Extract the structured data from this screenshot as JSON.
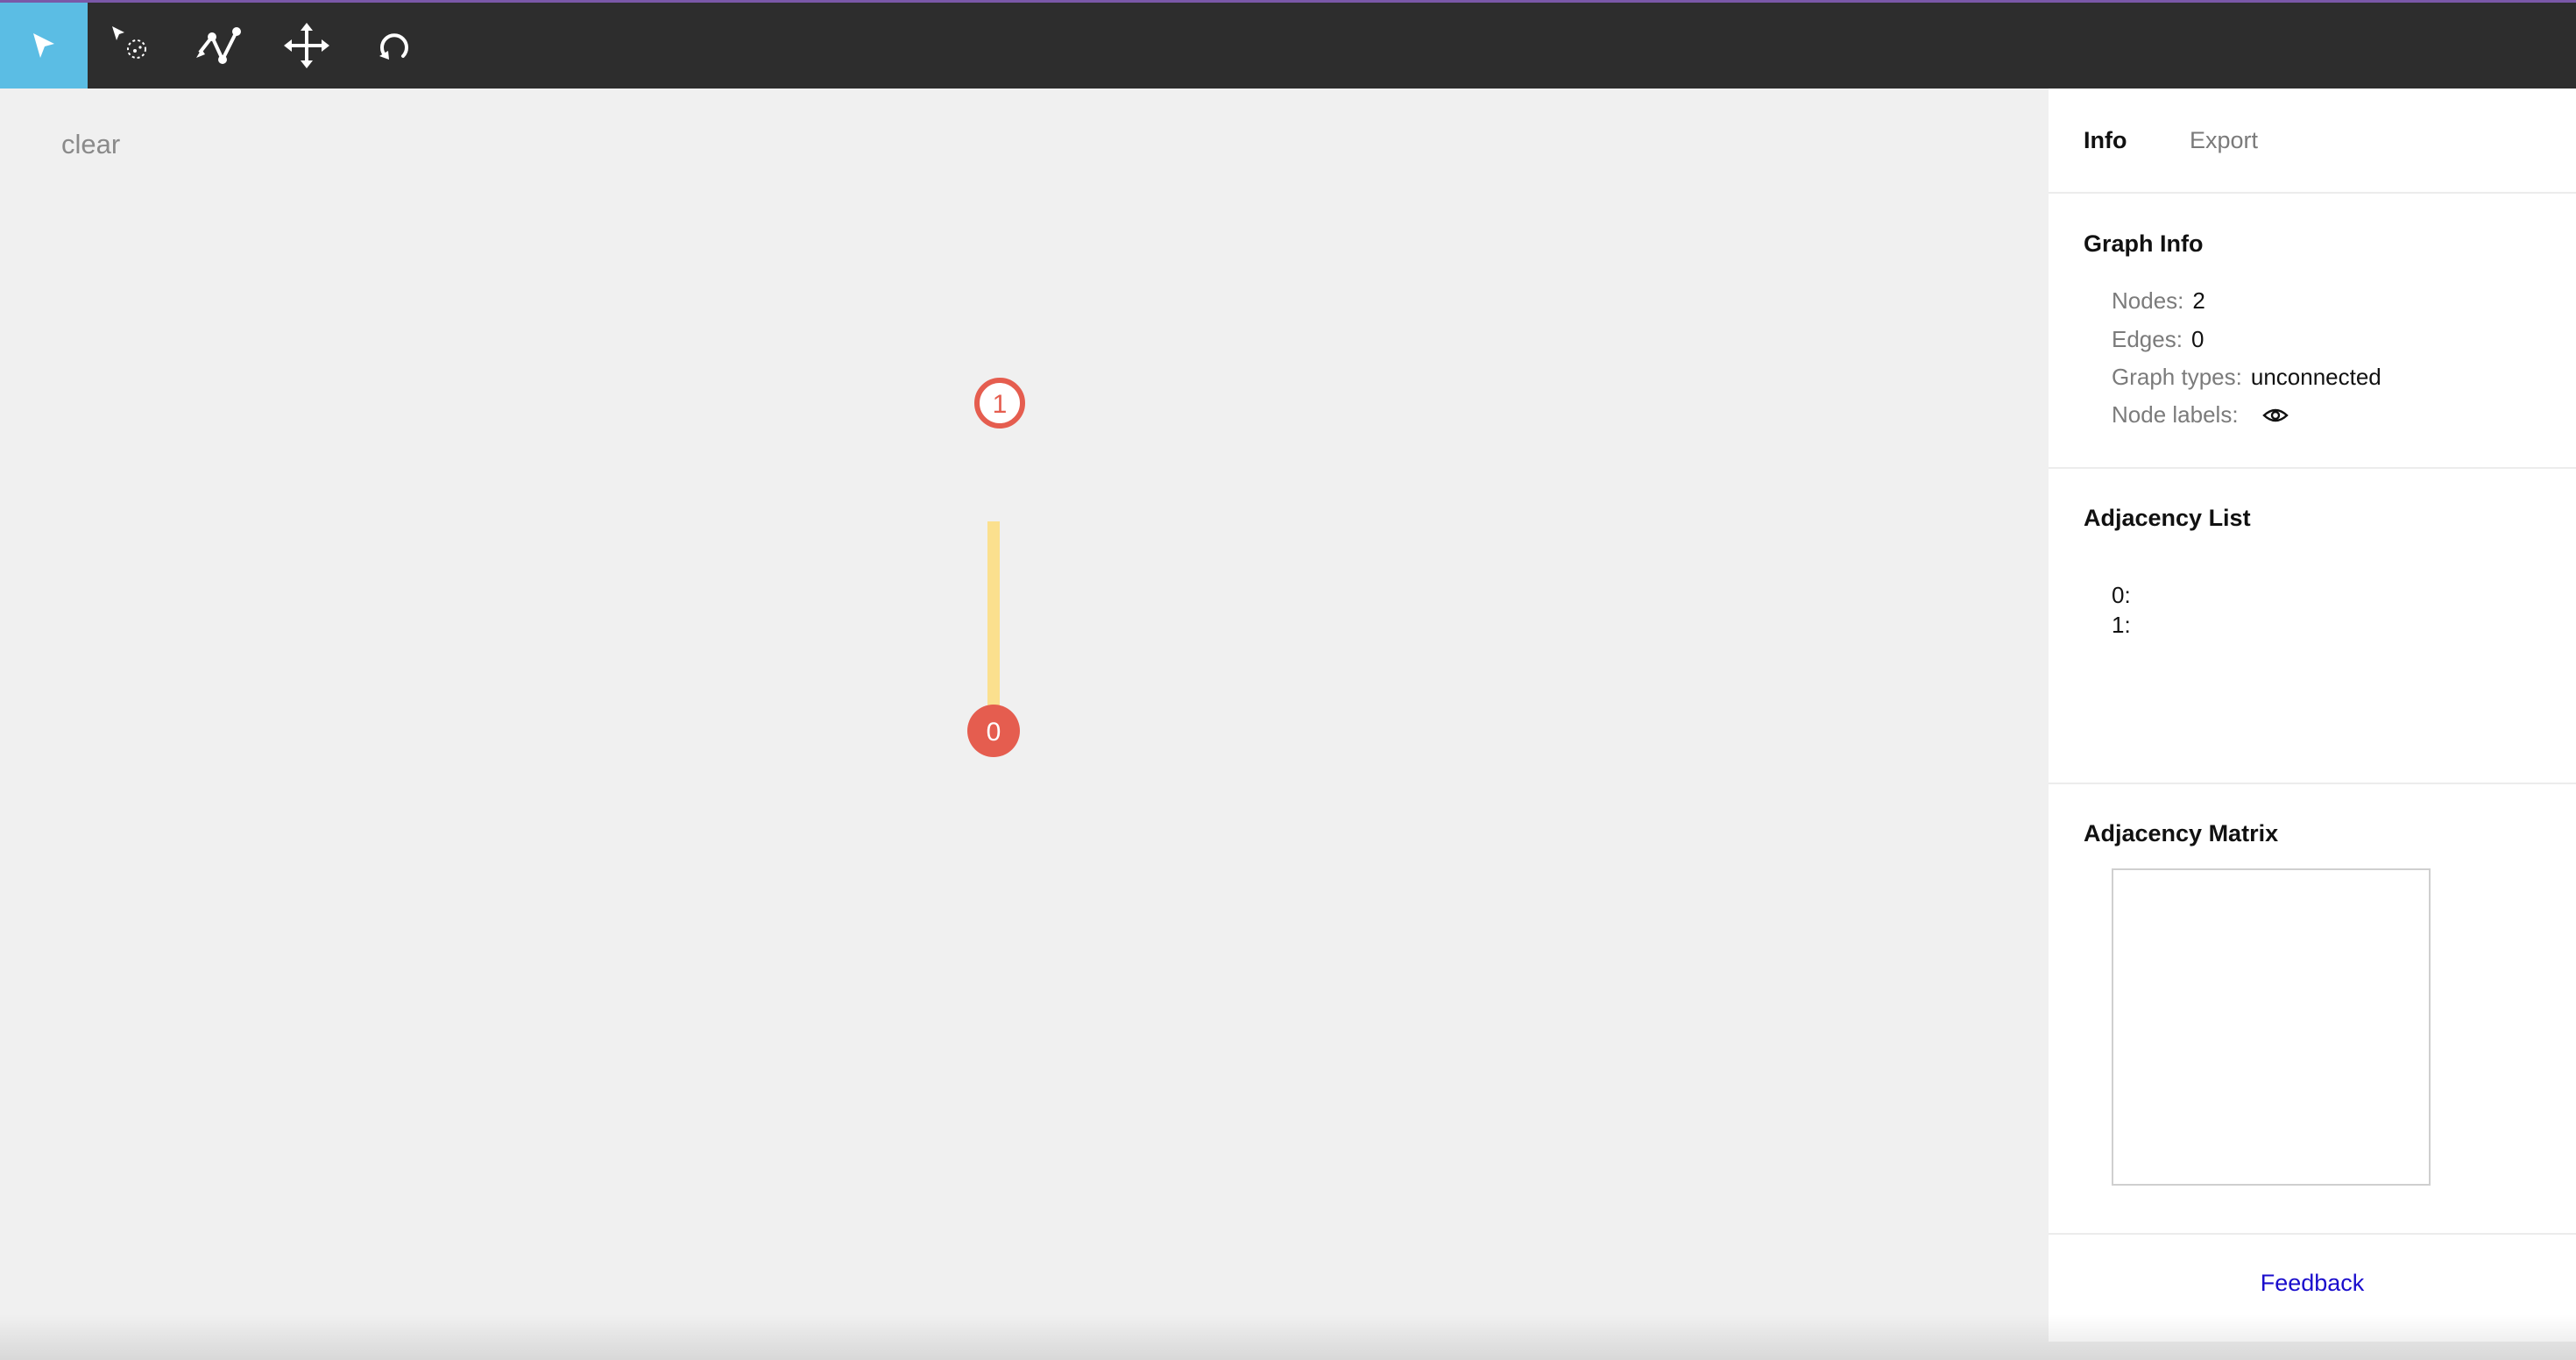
{
  "toolbar": {
    "tools": [
      {
        "icon": "pointer-icon",
        "active": true
      },
      {
        "icon": "lasso-select-icon",
        "active": false
      },
      {
        "icon": "graph-edge-icon",
        "active": false
      },
      {
        "icon": "move-icon",
        "active": false
      },
      {
        "icon": "refresh-icon",
        "active": false
      }
    ],
    "accent_color": "#5bbde4",
    "bar_color": "#2d2d2d"
  },
  "canvas": {
    "clear_label": "clear",
    "nodes": [
      {
        "id": "0",
        "label": "0",
        "style": "filled",
        "color": "#e55d4f"
      },
      {
        "id": "1",
        "label": "1",
        "style": "outline",
        "color": "#e55d4f"
      }
    ],
    "edges": [],
    "drag_line_color": "#fbe08e"
  },
  "panel": {
    "tabs": {
      "info": "Info",
      "export": "Export"
    },
    "graph_info": {
      "title": "Graph Info",
      "nodes_label": "Nodes:",
      "nodes_value": "2",
      "edges_label": "Edges:",
      "edges_value": "0",
      "types_label": "Graph types:",
      "types_value": "unconnected",
      "labels_label": "Node labels:",
      "labels_icon": "eye-icon"
    },
    "adjacency_list": {
      "title": "Adjacency List",
      "rows": [
        "0:",
        "1:"
      ]
    },
    "adjacency_matrix": {
      "title": "Adjacency Matrix"
    },
    "feedback_label": "Feedback"
  }
}
